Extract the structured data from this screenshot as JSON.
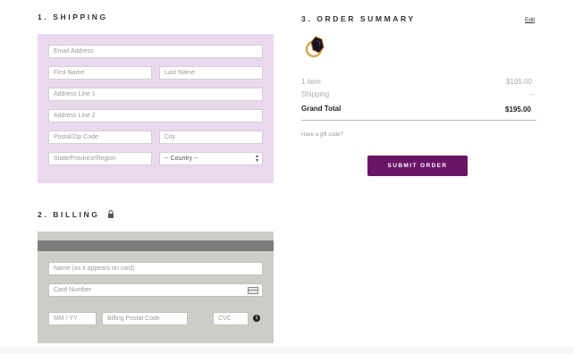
{
  "shipping": {
    "title": "1. SHIPPING",
    "email_placeholder": "Email Address",
    "first_name_placeholder": "First Name",
    "last_name_placeholder": "Last Name",
    "address1_placeholder": "Address Line 1",
    "address2_placeholder": "Address Line 2",
    "postal_placeholder": "Postal/Zip Code",
    "city_placeholder": "City",
    "state_placeholder": "State/Province/Region",
    "country_selected": "-- Country --",
    "panel_color": "#ead9ee"
  },
  "billing": {
    "title": "2. BILLING",
    "name_placeholder": "Name (as it appears on card)",
    "card_number_placeholder": "Card Number",
    "expiry_placeholder": "MM / YY",
    "billing_postal_placeholder": "Billing Postal Code",
    "cvc_placeholder": "CVC",
    "panel_color": "#cdccc6"
  },
  "summary": {
    "title": "3. ORDER SUMMARY",
    "edit_label": "Edit",
    "items_label": "1 item",
    "items_value": "$195.00",
    "shipping_label": "Shipping",
    "shipping_value": "--",
    "total_label": "Grand Total",
    "total_value": "$195.00",
    "gift_code_label": "Have a gift code?",
    "submit_label": "SUBMIT ORDER",
    "accent_color": "#6a1468"
  },
  "icons": {
    "lock": "lock-icon",
    "card": "credit-card-icon",
    "info": "info-icon",
    "product": "ring-product-thumbnail"
  }
}
